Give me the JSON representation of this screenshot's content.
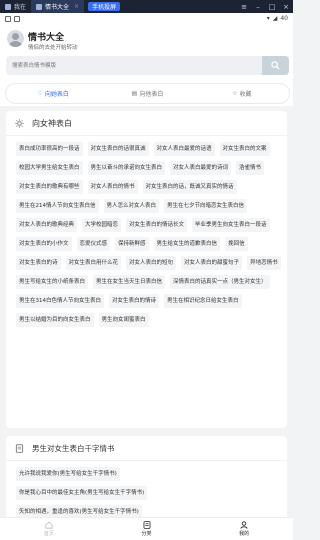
{
  "os_tabs": [
    {
      "label": "我在",
      "active": false
    },
    {
      "label": "情书大全",
      "active": true
    }
  ],
  "os_promo": "手机投屏",
  "status_bar": {
    "time": "",
    "battery": "40"
  },
  "header": {
    "title": "情书大全",
    "subtitle": "情侣的去处开始转动",
    "search_placeholder": "搜索表白情书模版"
  },
  "filter_tabs": [
    {
      "icon": "heart",
      "label": "向她表白",
      "active": true
    },
    {
      "icon": "doc",
      "label": "向他表白",
      "active": false
    },
    {
      "icon": "star",
      "label": "收藏",
      "active": false
    }
  ],
  "section1": {
    "title": "向女神表白",
    "tags": [
      "表白成功率很高的一段话",
      "对女生表白的话很真诚",
      "对女人表白最爱的话语",
      "对女生表白的文案",
      "校园大学男生给女生表白",
      "男生以奋斗的承诺向女生表白",
      "对女人表白最爱的诗词",
      "浩雀情书",
      "对女生表白的歌典有哪些",
      "对女人表白的情书",
      "对女生表白的话，既诚又真实的情话",
      "男生在214情人节向女生表白信",
      "男人怎么对女人表白",
      "男生在七夕节向暗恋女生表白信",
      "对女人表白的歌典经典",
      "大学校园暗恋",
      "对女生表白的情话长文",
      "毕业季男生向女生表白一段话",
      "对女生表白的小作文",
      "恋爱仪式感",
      "保持新鲜感",
      "男生给女生的道歉表白信",
      "挽回信",
      "对女生表白的诗",
      "对女生表白用什么花",
      "对女人表白的短句",
      "对女人表白的甜蜜句子",
      "异地恋情书",
      "男生写给女生的小纸条表白",
      "男生在女生当天生日表白信",
      "深情表白的话真实一点（男生对女生）",
      "男生在314白色情人节向女生表白",
      "对女生表白的情诗",
      "男生在相识纪念日给女生表白",
      "男生以结婚为目的向女生表白",
      "男生向女闺蜜表白"
    ]
  },
  "section2": {
    "title": "男生对女生表白千字情书",
    "items": [
      "允许我说我爱你(男生写给女生千字情书)",
      "你是我心目中的最佳女主角(男生写给女生千字情书)",
      "矢知的相遇，重逢的喜欢(男生写给女生千字情书)"
    ]
  },
  "bottom_nav": [
    {
      "label": "首页",
      "icon": "home",
      "active": false
    },
    {
      "label": "分类",
      "icon": "list",
      "active": true
    },
    {
      "label": "我的",
      "icon": "user",
      "active": false
    }
  ]
}
